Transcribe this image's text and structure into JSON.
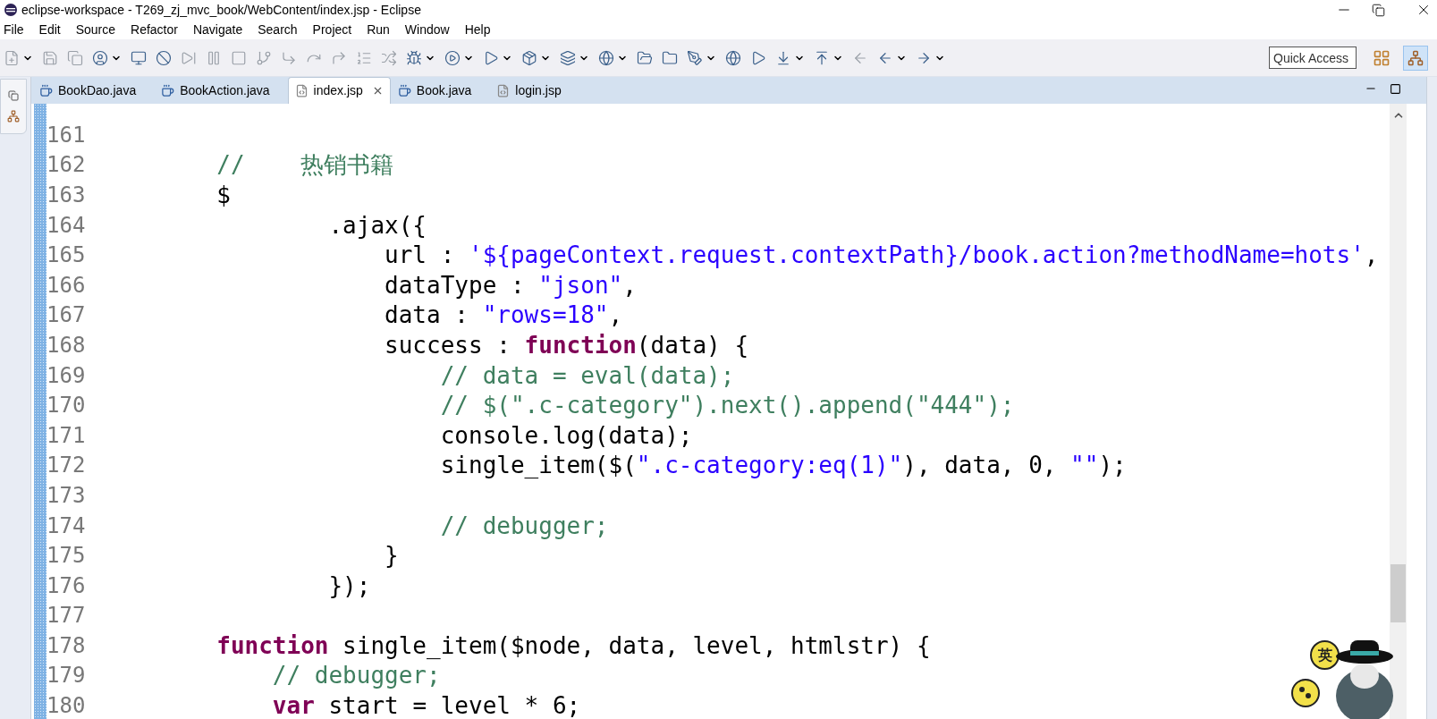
{
  "window": {
    "title": "eclipse-workspace - T269_zj_mvc_book/WebContent/index.jsp - Eclipse"
  },
  "menu": [
    "File",
    "Edit",
    "Source",
    "Refactor",
    "Navigate",
    "Search",
    "Project",
    "Run",
    "Window",
    "Help"
  ],
  "toolbar": {
    "quick_access": {
      "placeholder": "Quick Access"
    }
  },
  "tabs": [
    {
      "label": "BookDao.java",
      "kind": "java",
      "selected": false
    },
    {
      "label": "BookAction.java",
      "kind": "java",
      "selected": false
    },
    {
      "label": "index.jsp",
      "kind": "jsp",
      "selected": true
    },
    {
      "label": "Book.java",
      "kind": "java",
      "selected": false
    },
    {
      "label": "login.jsp",
      "kind": "jsp",
      "selected": false
    }
  ],
  "editor": {
    "lines": [
      {
        "number": "161"
      },
      {
        "number": "162",
        "segments": [
          {
            "kind": "comment",
            "text": "        //    热销书籍"
          }
        ]
      },
      {
        "number": "163",
        "segments": [
          {
            "kind": "plain",
            "text": "        $"
          }
        ]
      },
      {
        "number": "164",
        "segments": [
          {
            "kind": "plain",
            "text": "                .ajax({"
          }
        ]
      },
      {
        "number": "165",
        "segments": [
          {
            "kind": "plain",
            "text": "                    url : "
          },
          {
            "kind": "string",
            "text": "'${pageContext.request.contextPath}/book.action?methodName=hots'"
          },
          {
            "kind": "plain",
            "text": ","
          }
        ]
      },
      {
        "number": "166",
        "segments": [
          {
            "kind": "plain",
            "text": "                    dataType : "
          },
          {
            "kind": "string",
            "text": "\"json\""
          },
          {
            "kind": "plain",
            "text": ","
          }
        ]
      },
      {
        "number": "167",
        "segments": [
          {
            "kind": "plain",
            "text": "                    data : "
          },
          {
            "kind": "string",
            "text": "\"rows=18\""
          },
          {
            "kind": "plain",
            "text": ","
          }
        ]
      },
      {
        "number": "168",
        "segments": [
          {
            "kind": "plain",
            "text": "                    success : "
          },
          {
            "kind": "keyword",
            "text": "function"
          },
          {
            "kind": "plain",
            "text": "(data) {"
          }
        ]
      },
      {
        "number": "169",
        "segments": [
          {
            "kind": "comment",
            "text": "                        // data = eval(data);"
          }
        ]
      },
      {
        "number": "170",
        "segments": [
          {
            "kind": "comment",
            "text": "                        // $(\".c-category\").next().append(\"444\");"
          }
        ]
      },
      {
        "number": "171",
        "segments": [
          {
            "kind": "plain",
            "text": "                        console.log(data);"
          }
        ]
      },
      {
        "number": "172",
        "segments": [
          {
            "kind": "plain",
            "text": "                        single_item($("
          },
          {
            "kind": "string",
            "text": "\".c-category:eq(1)\""
          },
          {
            "kind": "plain",
            "text": "), data, 0, "
          },
          {
            "kind": "string",
            "text": "\"\""
          },
          {
            "kind": "plain",
            "text": ");"
          }
        ]
      },
      {
        "number": "173"
      },
      {
        "number": "174",
        "segments": [
          {
            "kind": "comment",
            "text": "                        // debugger;"
          }
        ]
      },
      {
        "number": "175",
        "segments": [
          {
            "kind": "plain",
            "text": "                    }"
          }
        ]
      },
      {
        "number": "176",
        "segments": [
          {
            "kind": "plain",
            "text": "                });"
          }
        ]
      },
      {
        "number": "177"
      },
      {
        "number": "178",
        "segments": [
          {
            "kind": "keyword",
            "text": "        function"
          },
          {
            "kind": "plain",
            "text": " single_item($node, data, level, htmlstr) {"
          }
        ]
      },
      {
        "number": "179",
        "segments": [
          {
            "kind": "comment",
            "text": "            // debugger;"
          }
        ]
      },
      {
        "number": "180",
        "segments": [
          {
            "kind": "keyword",
            "text": "            var"
          },
          {
            "kind": "plain",
            "text": " start = level * 6;"
          }
        ]
      }
    ]
  },
  "ime": {
    "mode": "英"
  }
}
